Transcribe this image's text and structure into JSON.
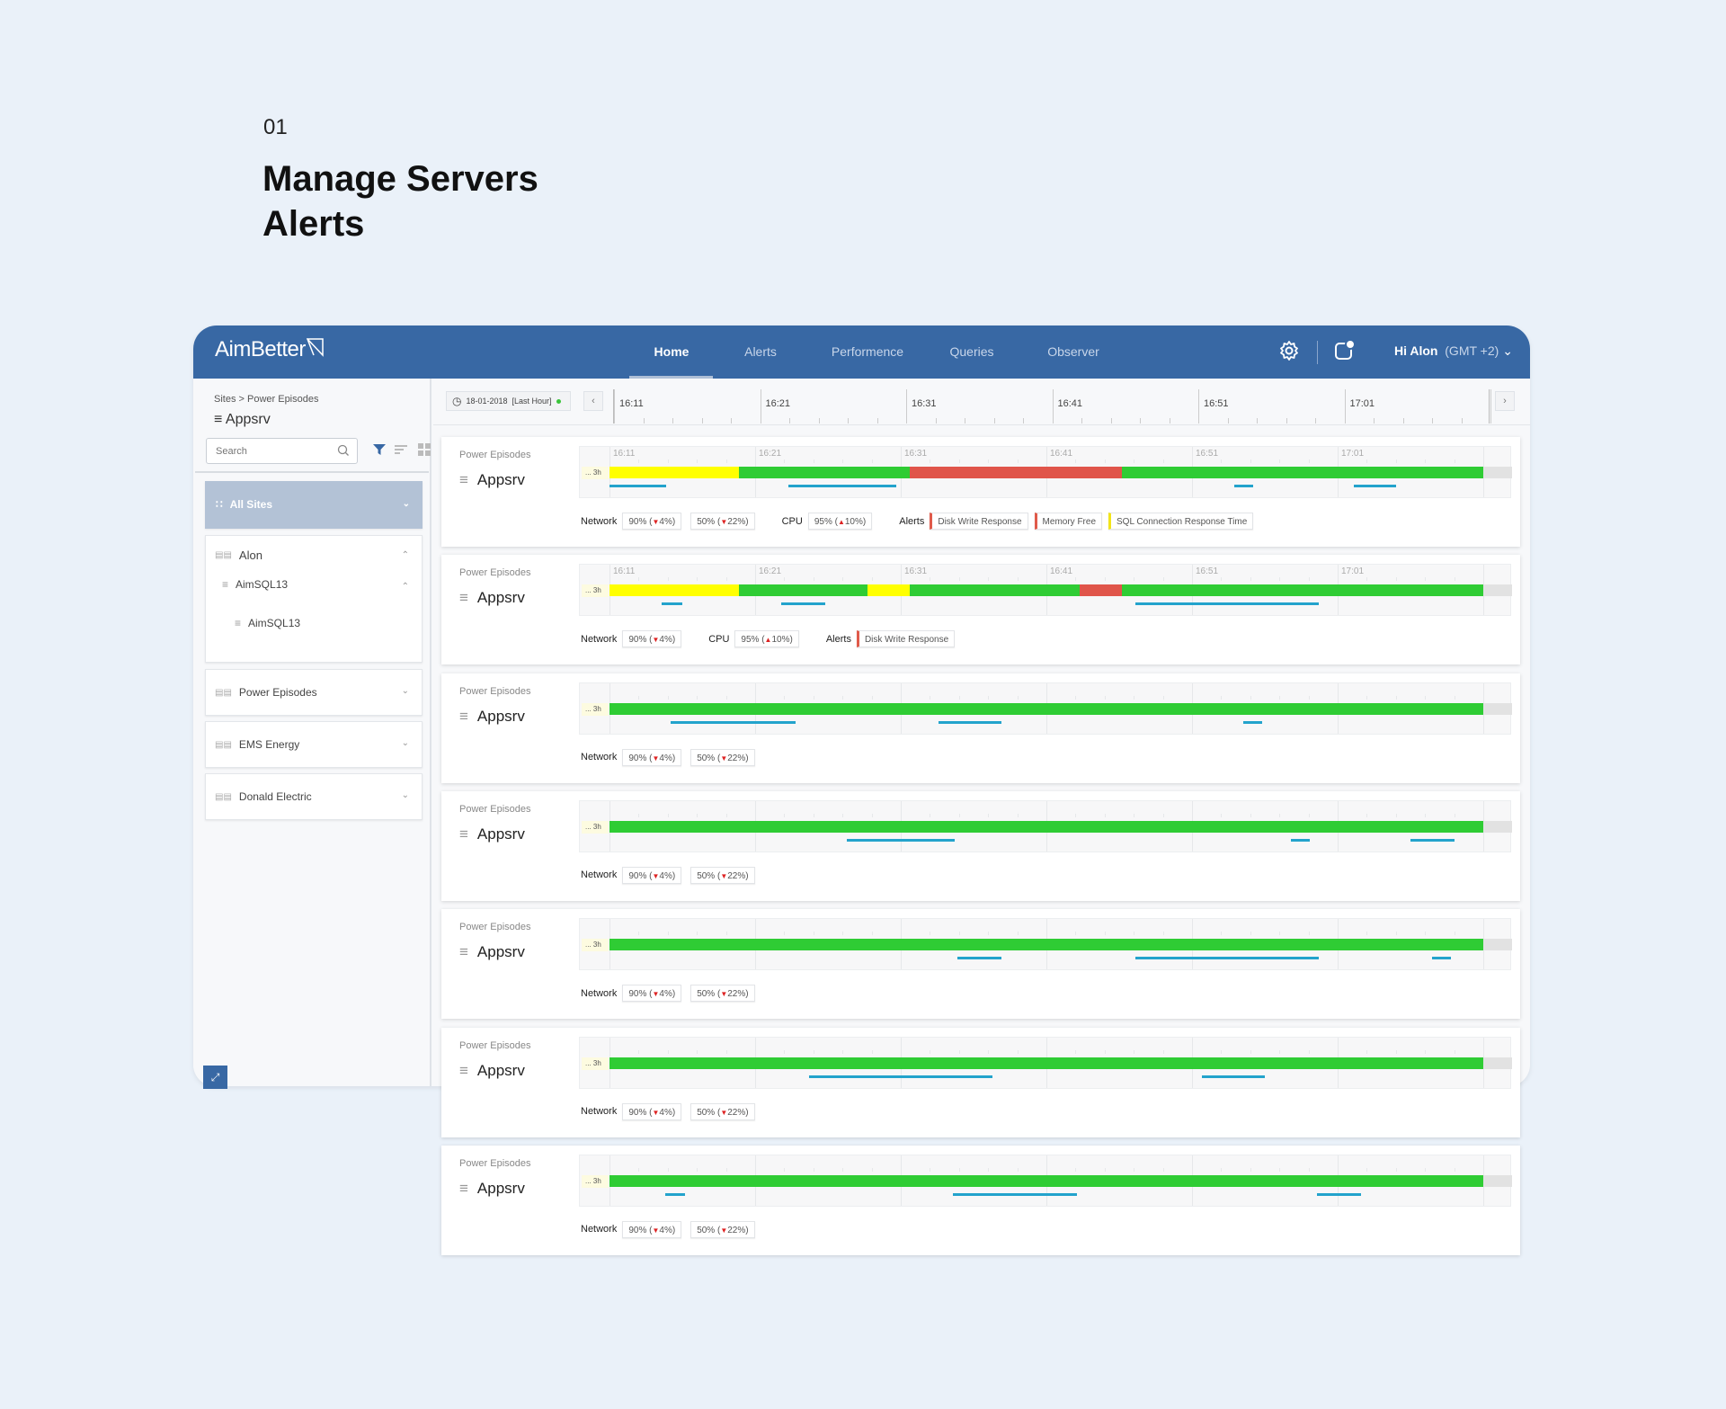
{
  "page": {
    "number": "01",
    "title_line1": "Manage Servers",
    "title_line2": "Alerts"
  },
  "colors": {
    "header": "#3868a4",
    "ok": "#2fcc34",
    "warning": "#ffff00",
    "critical": "#e0554a",
    "network_line": "#23a3cc",
    "page_bg": "#eaf1f9"
  },
  "header": {
    "logo": "AimBetter",
    "nav": [
      {
        "label": "Home",
        "active": true
      },
      {
        "label": "Alerts"
      },
      {
        "label": "Performence"
      },
      {
        "label": "Queries"
      },
      {
        "label": "Observer"
      }
    ],
    "greeting": "Hi Alon",
    "timezone": "(GMT +2)",
    "icons": [
      "gear-icon",
      "notification-icon",
      "chevron-down-icon"
    ]
  },
  "sidebar": {
    "breadcrumb": "Sites > Power Episodes",
    "title": "Appsrv",
    "search_placeholder": "Search",
    "all_sites": "All Sites",
    "groups": [
      {
        "label": "Alon",
        "expanded": true,
        "children": [
          {
            "label": "AimSQL13",
            "children": [
              {
                "label": "AimSQL13"
              }
            ]
          }
        ]
      },
      {
        "label": "Power Episodes"
      },
      {
        "label": "EMS Energy"
      },
      {
        "label": "Donald Electric"
      }
    ]
  },
  "timeline": {
    "date": "18-01-2018",
    "range": "[Last Hour]",
    "ticks": [
      "16:11",
      "16:21",
      "16:31",
      "16:41",
      "16:51",
      "17:01"
    ],
    "start": "16:11",
    "end": "17:11"
  },
  "cards": [
    {
      "group": "Power Episodes",
      "name": "Appsrv",
      "range_label": "... 3h",
      "segments": [
        [
          "16:11",
          "16:19.9",
          "warning"
        ],
        [
          "16:19.9",
          "16:31.6",
          "ok"
        ],
        [
          "16:31.6",
          "16:46.2",
          "critical"
        ],
        [
          "16:46.2",
          "17:11",
          "ok"
        ]
      ],
      "network_lines": [
        [
          "16:11",
          "16:14.9"
        ],
        [
          "16:23.3",
          "16:30.7"
        ],
        [
          "16:53.9",
          "16:55.2"
        ],
        [
          "17:02.1",
          "17:05"
        ]
      ],
      "network": [
        "90% (",
        "4%)",
        "50% (",
        "22%)"
      ],
      "cpu": [
        "95% (",
        "10%)"
      ],
      "alerts": [
        {
          "label": "Disk Write Response",
          "level": "critical"
        },
        {
          "label": "Memory Free",
          "level": "critical"
        },
        {
          "label": "SQL Connection Response Time",
          "level": "warning"
        }
      ]
    },
    {
      "group": "Power Episodes",
      "name": "Appsrv",
      "range_label": "... 3h",
      "segments": [
        [
          "16:11",
          "16:19.9",
          "warning"
        ],
        [
          "16:19.9",
          "16:28.7",
          "ok"
        ],
        [
          "16:28.7",
          "16:31.6",
          "warning"
        ],
        [
          "16:31.6",
          "16:43.3",
          "ok"
        ],
        [
          "16:43.3",
          "16:46.2",
          "critical"
        ],
        [
          "16:46.2",
          "17:11",
          "ok"
        ]
      ],
      "network_lines": [
        [
          "16:14.6",
          "16:16"
        ],
        [
          "16:22.8",
          "16:25.8"
        ],
        [
          "16:47.1",
          "16:59.7"
        ]
      ],
      "network": [
        "90% (",
        "4%)"
      ],
      "cpu": [
        "95% (",
        "10%)"
      ],
      "alerts": [
        {
          "label": "Disk Write Response",
          "level": "critical"
        }
      ]
    },
    {
      "group": "Power Episodes",
      "name": "Appsrv",
      "range_label": "... 3h",
      "segments": [
        [
          "16:11",
          "17:11",
          "ok"
        ]
      ],
      "network_lines": [
        [
          "16:15.2",
          "16:23.8"
        ],
        [
          "16:33.6",
          "16:37.9"
        ],
        [
          "16:54.5",
          "16:55.8"
        ]
      ],
      "network": [
        "90% (",
        "4%)",
        "50% (",
        "22%)"
      ]
    },
    {
      "group": "Power Episodes",
      "name": "Appsrv",
      "range_label": "... 3h",
      "segments": [
        [
          "16:11",
          "17:11",
          "ok"
        ]
      ],
      "network_lines": [
        [
          "16:27.3",
          "16:34.7"
        ],
        [
          "16:57.8",
          "16:59.1"
        ],
        [
          "17:06",
          "17:09"
        ]
      ],
      "network": [
        "90% (",
        "4%)",
        "50% (",
        "22%)"
      ]
    },
    {
      "group": "Power Episodes",
      "name": "Appsrv",
      "range_label": "... 3h",
      "segments": [
        [
          "16:11",
          "17:11",
          "ok"
        ]
      ],
      "network_lines": [
        [
          "16:34.9",
          "16:37.9"
        ],
        [
          "16:47.1",
          "16:59.7"
        ],
        [
          "17:07.5",
          "17:08.8"
        ]
      ],
      "network": [
        "90% (",
        "4%)",
        "50% (",
        "22%)"
      ]
    },
    {
      "group": "Power Episodes",
      "name": "Appsrv",
      "range_label": "... 3h",
      "segments": [
        [
          "16:11",
          "17:11",
          "ok"
        ]
      ],
      "network_lines": [
        [
          "16:24.7",
          "16:37.3"
        ],
        [
          "16:51.7",
          "16:56"
        ]
      ],
      "network": [
        "90% (",
        "4%)",
        "50% (",
        "22%)"
      ]
    },
    {
      "group": "Power Episodes",
      "name": "Appsrv",
      "range_label": "... 3h",
      "segments": [
        [
          "16:11",
          "17:11",
          "ok"
        ]
      ],
      "network_lines": [
        [
          "16:14.8",
          "16:16.2"
        ],
        [
          "16:34.6",
          "16:43.1"
        ],
        [
          "16:59.6",
          "17:02.6"
        ]
      ],
      "network": [
        "90% (",
        "4%)",
        "50% (",
        "22%)"
      ]
    }
  ],
  "labels": {
    "network": "Network",
    "cpu": "CPU",
    "alerts": "Alerts"
  }
}
